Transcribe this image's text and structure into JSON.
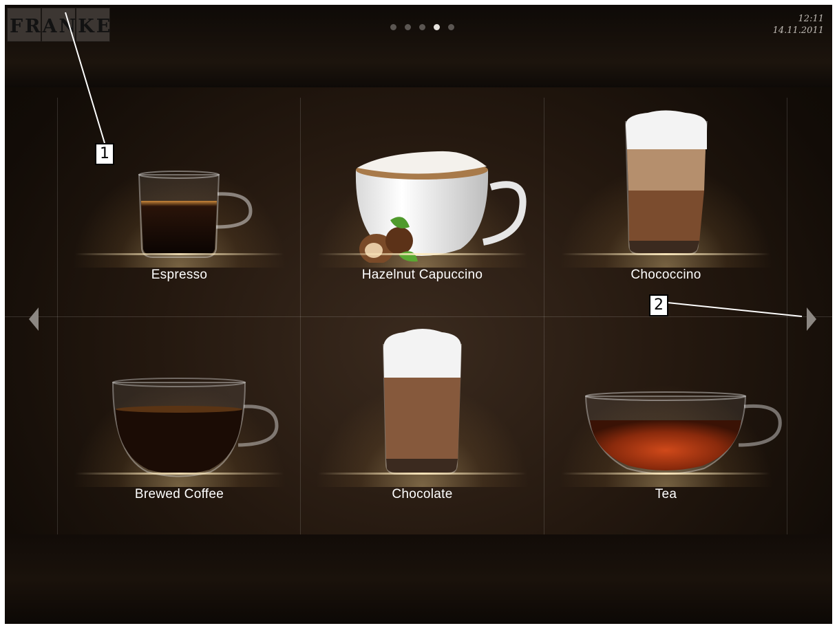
{
  "header": {
    "logo_text": "FRANKE",
    "time": "12:11",
    "date": "14.11.2011",
    "pager": {
      "pages": 5,
      "active_page": 4
    }
  },
  "products": [
    {
      "label": "Espresso",
      "icon": "espresso-cup-icon"
    },
    {
      "label": "Hazelnut Capuccino",
      "icon": "hazelnut-cappuccino-cup-icon"
    },
    {
      "label": "Chococcino",
      "icon": "chococcino-glass-icon"
    },
    {
      "label": "Brewed Coffee",
      "icon": "coffee-cup-icon"
    },
    {
      "label": "Chocolate",
      "icon": "chocolate-glass-icon"
    },
    {
      "label": "Tea",
      "icon": "tea-cup-icon"
    }
  ],
  "navigation": {
    "prev_icon": "arrow-left-icon",
    "next_icon": "arrow-right-icon"
  },
  "callouts": [
    {
      "number": "1"
    },
    {
      "number": "2"
    }
  ],
  "colors": {
    "background": "#1c140d",
    "label_text": "#ffffff",
    "pager_active": "#e6e2dd",
    "pager_inactive": "#5b5652"
  }
}
